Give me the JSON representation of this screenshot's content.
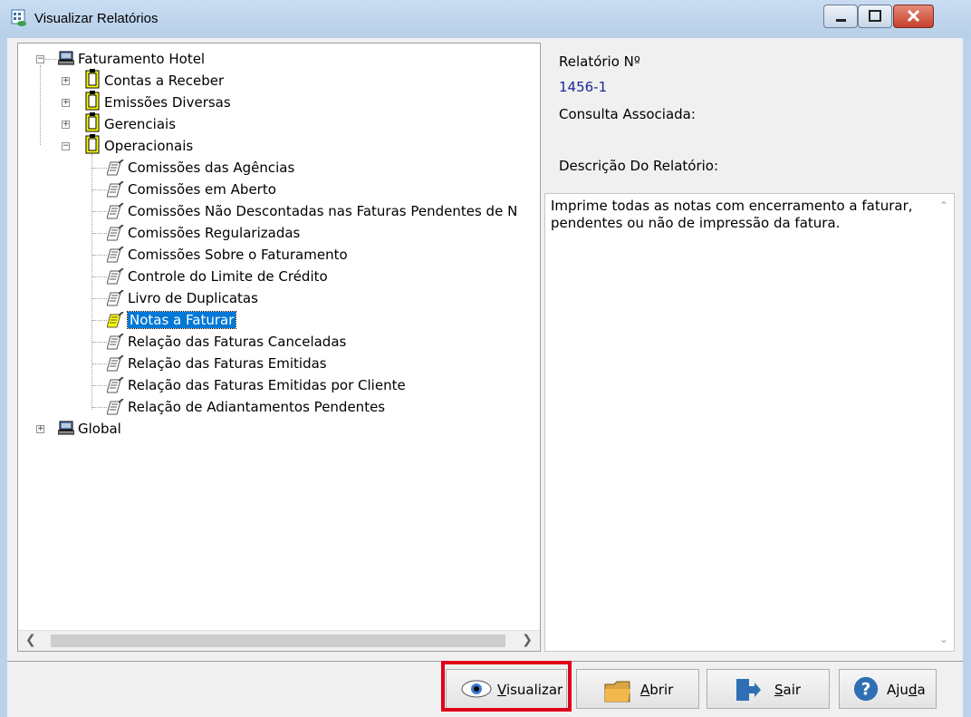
{
  "window": {
    "title": "Visualizar Relatórios"
  },
  "tree": {
    "root1": {
      "label": "Faturamento Hotel"
    },
    "groups": [
      {
        "label": "Contas a Receber"
      },
      {
        "label": "Emissões Diversas"
      },
      {
        "label": "Gerenciais"
      },
      {
        "label": "Operacionais"
      }
    ],
    "reports": [
      {
        "label": "Comissões das Agências"
      },
      {
        "label": "Comissões em Aberto"
      },
      {
        "label": "Comissões Não Descontadas nas Faturas Pendentes de N"
      },
      {
        "label": "Comissões Regularizadas"
      },
      {
        "label": "Comissões Sobre o Faturamento"
      },
      {
        "label": "Controle do Limite de Crédito"
      },
      {
        "label": "Livro de Duplicatas"
      },
      {
        "label": "Notas a Faturar"
      },
      {
        "label": "Relação das Faturas Canceladas"
      },
      {
        "label": "Relação das Faturas Emitidas"
      },
      {
        "label": "Relação das Faturas Emitidas por Cliente"
      },
      {
        "label": "Relação de Adiantamentos Pendentes"
      }
    ],
    "root2": {
      "label": "Global"
    },
    "selected": "Notas a Faturar"
  },
  "info": {
    "report_no_label": "Relatório Nº",
    "report_no_value": "1456-1",
    "query_label": "Consulta Associada:",
    "desc_label": "Descrição Do Relatório:",
    "desc_text": "Imprime todas as notas com encerramento a faturar, pendentes ou não de impressão da fatura."
  },
  "buttons": {
    "view": {
      "label": "Visualizar",
      "mnemonic": "V"
    },
    "open": {
      "label": "Abrir",
      "mnemonic": "A"
    },
    "exit": {
      "label": "Sair",
      "mnemonic": "S"
    },
    "help": {
      "label": "Ajuda",
      "mnemonic": "d"
    }
  },
  "colors": {
    "selection": "#0078d7",
    "highlight_box": "#e0001a",
    "value_text": "#1a2a9a"
  }
}
